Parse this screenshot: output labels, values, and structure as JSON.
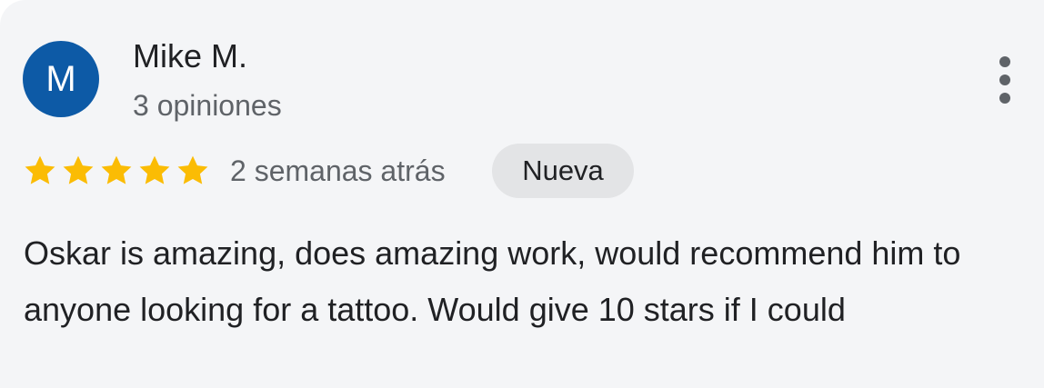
{
  "reviewer": {
    "initial": "M",
    "name": "Mike M.",
    "review_count": "3 opiniones",
    "avatar_color": "#0d5aa6"
  },
  "rating": {
    "stars": 5,
    "max_stars": 5,
    "star_color": "#fbbc04"
  },
  "time_ago": "2 semanas atrás",
  "badge": "Nueva",
  "review_text": "Oskar is amazing, does amazing work, would recommend him to anyone looking for a tattoo. Would give 10 stars if I could",
  "more_menu_icon": "more-vert-icon"
}
